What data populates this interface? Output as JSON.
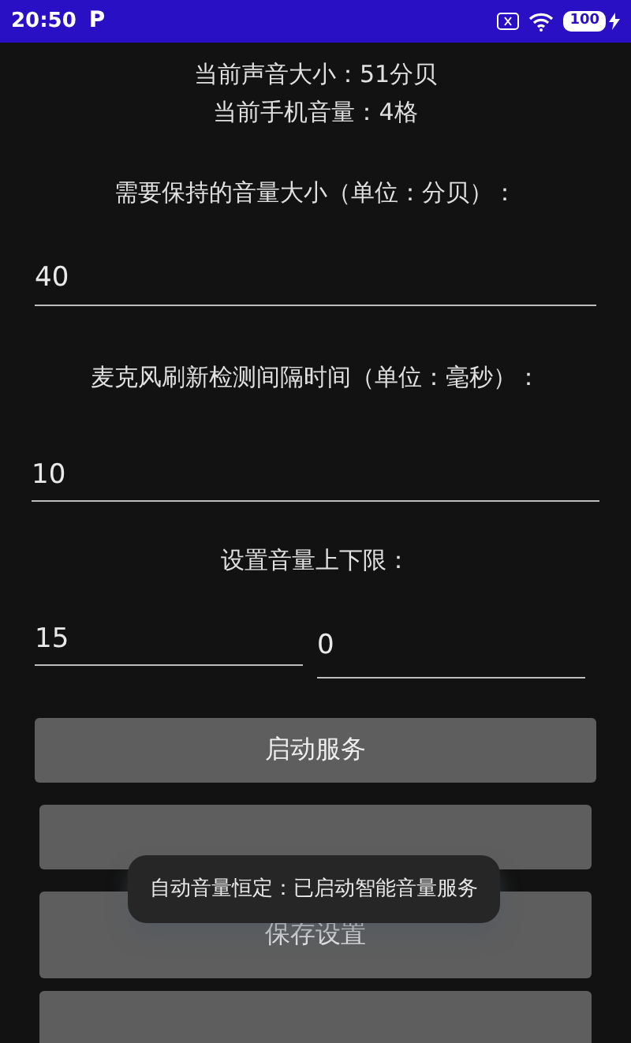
{
  "status_bar": {
    "time": "20:50",
    "app_badge": "P",
    "battery": "100"
  },
  "info": [
    "当前声音大小：51分贝",
    "当前手机音量：4格"
  ],
  "target_label": "需要保持的音量大小（单位：分贝）：",
  "target_value": "40",
  "interval_label": "麦克风刷新检测间隔时间（单位：毫秒）：",
  "interval_value": "10",
  "limits_label": "设置音量上下限：",
  "limits": [
    "15",
    "0"
  ],
  "buttons": [
    {
      "kind": "labeled",
      "label": "启动服务"
    },
    {
      "kind": "covered"
    },
    {
      "kind": "labeled",
      "label": "保存设置"
    },
    {
      "kind": "cut"
    }
  ],
  "toast": "自动音量恒定：已启动智能音量服务"
}
